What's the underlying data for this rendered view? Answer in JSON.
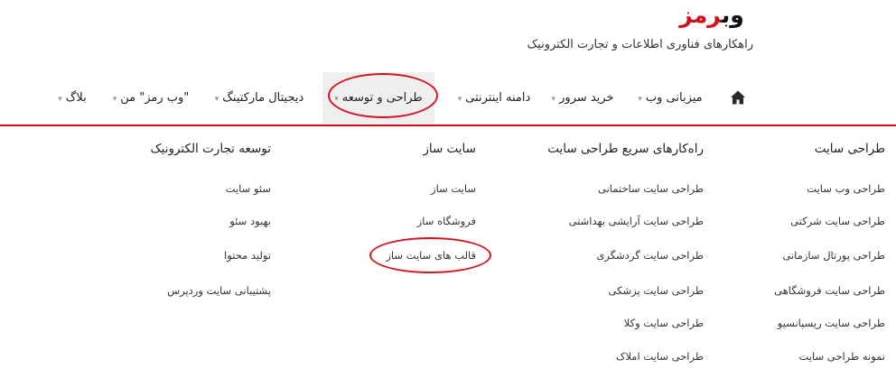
{
  "header": {
    "logo": {
      "part_a": "وب",
      "part_b": "رمز"
    },
    "tagline": "راهکارهای فناوری اطلاعات و تجارت الکترونیک"
  },
  "nav": {
    "home_icon": "home-icon",
    "items": [
      {
        "label": "میزبانی وب"
      },
      {
        "label": "خرید سرور"
      },
      {
        "label": "دامنه اینترنتی"
      },
      {
        "label": "طراحی و توسعه",
        "active": true
      },
      {
        "label": "دیجیتال مارکتینگ"
      },
      {
        "label": "\"وب رمز\" من"
      },
      {
        "label": "بلاگ"
      }
    ],
    "caret_icon": "chevron-down-icon"
  },
  "menu": {
    "columns": [
      {
        "title": "طراحی سایت",
        "links": [
          "طراحی وب سایت",
          "طراحی سایت شرکتی",
          "طراحی پورتال سازمانی",
          "طراحی سایت فروشگاهی",
          "طراحی سایت ریسپانسیو",
          "نمونه طراحی سایت"
        ]
      },
      {
        "title": "راه‌کارهای سریع طراحی سایت",
        "links": [
          "طراحی سایت ساختمانی",
          "طراحی سایت آرایشی بهداشتی",
          "طراحی سایت گردشگری",
          "طراحی سایت پزشکی",
          "طراحی سایت وکلا",
          "طراحی سایت املاک"
        ]
      },
      {
        "title": "سایت ساز",
        "links": [
          "سایت ساز",
          "فروشگاه ساز",
          "قالب های سایت ساز"
        ]
      },
      {
        "title": "توسعه تجارت الکترونیک",
        "links": [
          "سئو سایت",
          "بهبود سئو",
          "تولید محتوا",
          "پشتیبانی سایت وردپرس"
        ]
      }
    ]
  },
  "colors": {
    "brand_red": "#d0101b",
    "annotation_red": "#d4161e",
    "active_bg": "#efefef"
  }
}
